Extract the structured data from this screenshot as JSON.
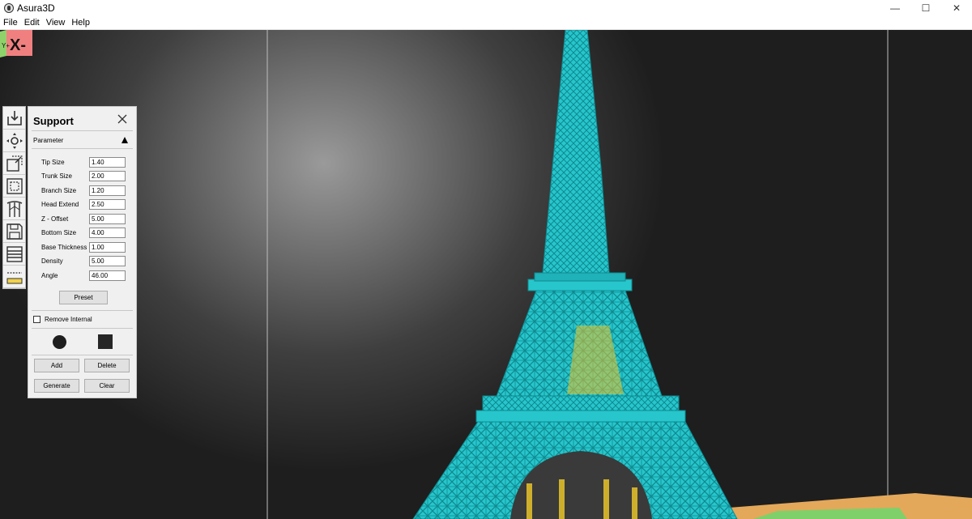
{
  "window": {
    "title": "Asura3D",
    "minimize": "—",
    "maximize": "☐",
    "close": "✕"
  },
  "menu": [
    "File",
    "Edit",
    "View",
    "Help"
  ],
  "toolbar": {
    "tools": [
      "import-icon",
      "move-icon",
      "scale-icon",
      "select-icon",
      "support-icon",
      "save-icon",
      "layers-icon",
      "slice-icon"
    ]
  },
  "support_panel": {
    "title": "Support",
    "section": "Parameter",
    "params": [
      {
        "label": "Tip Size",
        "value": "1.40"
      },
      {
        "label": "Trunk Size",
        "value": "2.00"
      },
      {
        "label": "Branch Size",
        "value": "1.20"
      },
      {
        "label": "Head Extend",
        "value": "2.50"
      },
      {
        "label": "Z - Offset",
        "value": "5.00"
      },
      {
        "label": "Bottom Size",
        "value": "4.00"
      },
      {
        "label": "Base Thickness",
        "value": "1.00"
      },
      {
        "label": "Density",
        "value": "5.00"
      },
      {
        "label": "Angle",
        "value": "46.00"
      }
    ],
    "preset_label": "Preset",
    "remove_internal_label": "Remove Internal",
    "remove_internal_checked": false,
    "add_label": "Add",
    "delete_label": "Delete",
    "generate_label": "Generate",
    "clear_label": "Clear"
  },
  "viewcube": {
    "face_label": "X-",
    "side_label": "Y+"
  },
  "colors": {
    "model": "#26c6cc",
    "model_dark": "#0f8a90",
    "support": "#e8c42a",
    "platform": "#e3a85a"
  }
}
